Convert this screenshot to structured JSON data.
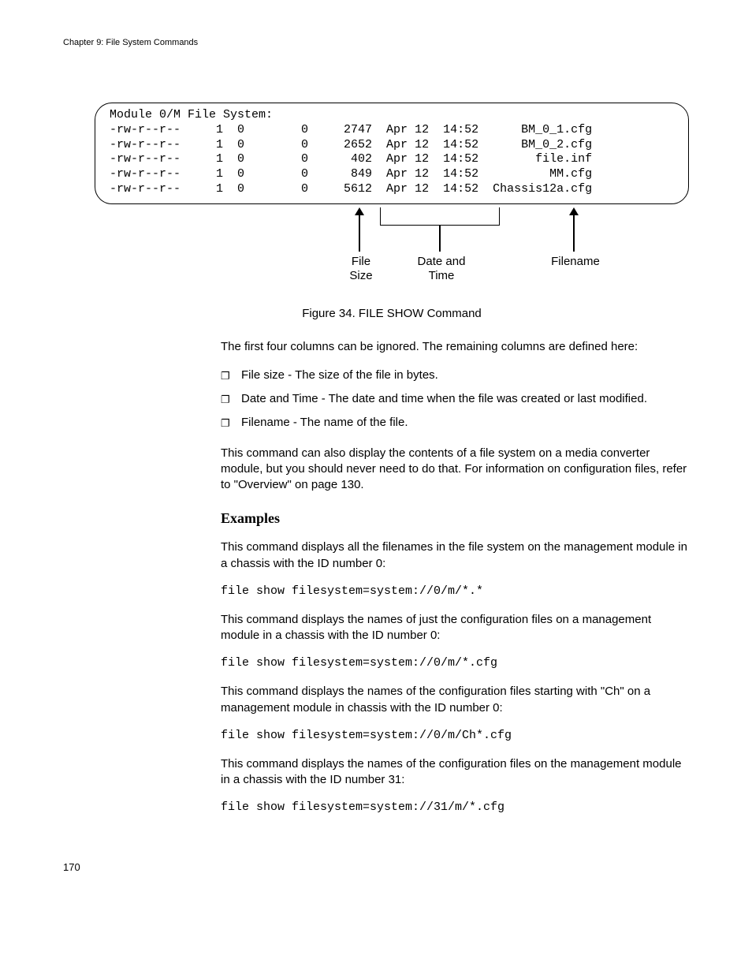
{
  "header": {
    "chapter": "Chapter 9: File System Commands"
  },
  "terminal": {
    "title": "Module 0/M File System:",
    "rows": [
      {
        "perm": "-rw-r--r--",
        "n": "1",
        "o": "0",
        "g": "0",
        "size": "2747",
        "date": "Apr 12",
        "time": "14:52",
        "name": "BM_0_1.cfg"
      },
      {
        "perm": "-rw-r--r--",
        "n": "1",
        "o": "0",
        "g": "0",
        "size": "2652",
        "date": "Apr 12",
        "time": "14:52",
        "name": "BM_0_2.cfg"
      },
      {
        "perm": "-rw-r--r--",
        "n": "1",
        "o": "0",
        "g": "0",
        "size": "402",
        "date": "Apr 12",
        "time": "14:52",
        "name": "file.inf"
      },
      {
        "perm": "-rw-r--r--",
        "n": "1",
        "o": "0",
        "g": "0",
        "size": "849",
        "date": "Apr 12",
        "time": "14:52",
        "name": "MM.cfg"
      },
      {
        "perm": "-rw-r--r--",
        "n": "1",
        "o": "0",
        "g": "0",
        "size": "5612",
        "date": "Apr 12",
        "time": "14:52",
        "name": "Chassis12a.cfg"
      }
    ]
  },
  "annotations": {
    "filesize_l1": "File",
    "filesize_l2": "Size",
    "datetime_l1": "Date and",
    "datetime_l2": "Time",
    "filename": "Filename"
  },
  "caption": "Figure 34. FILE SHOW Command",
  "p_intro": "The first four columns can be ignored. The remaining columns are defined here:",
  "bullets": {
    "b1": "File size - The size of the file in bytes.",
    "b2": "Date and Time - The date and time when the file was created or last modified.",
    "b3": "Filename - The name of the file."
  },
  "p_also": "This command can also display the contents of a file system on a media converter module, but you should never need to do that. For information on configuration files, refer to \"Overview\" on page 130.",
  "examples_heading": "Examples",
  "ex1_p": "This command displays all the filenames in the file system on the management module in a chassis with the ID number 0:",
  "ex1_c": "file show filesystem=system://0/m/*.*",
  "ex2_p": "This command displays the names of just the configuration files on a management module in a chassis with the ID number 0:",
  "ex2_c": "file show filesystem=system://0/m/*.cfg",
  "ex3_p": "This command displays the names of the configuration files starting with \"Ch\" on a management module in chassis with the ID number 0:",
  "ex3_c": "file show filesystem=system://0/m/Ch*.cfg",
  "ex4_p": "This command displays the names of the configuration files on the management module in a chassis with the ID number 31:",
  "ex4_c": "file show filesystem=system://31/m/*.cfg",
  "page_number": "170"
}
